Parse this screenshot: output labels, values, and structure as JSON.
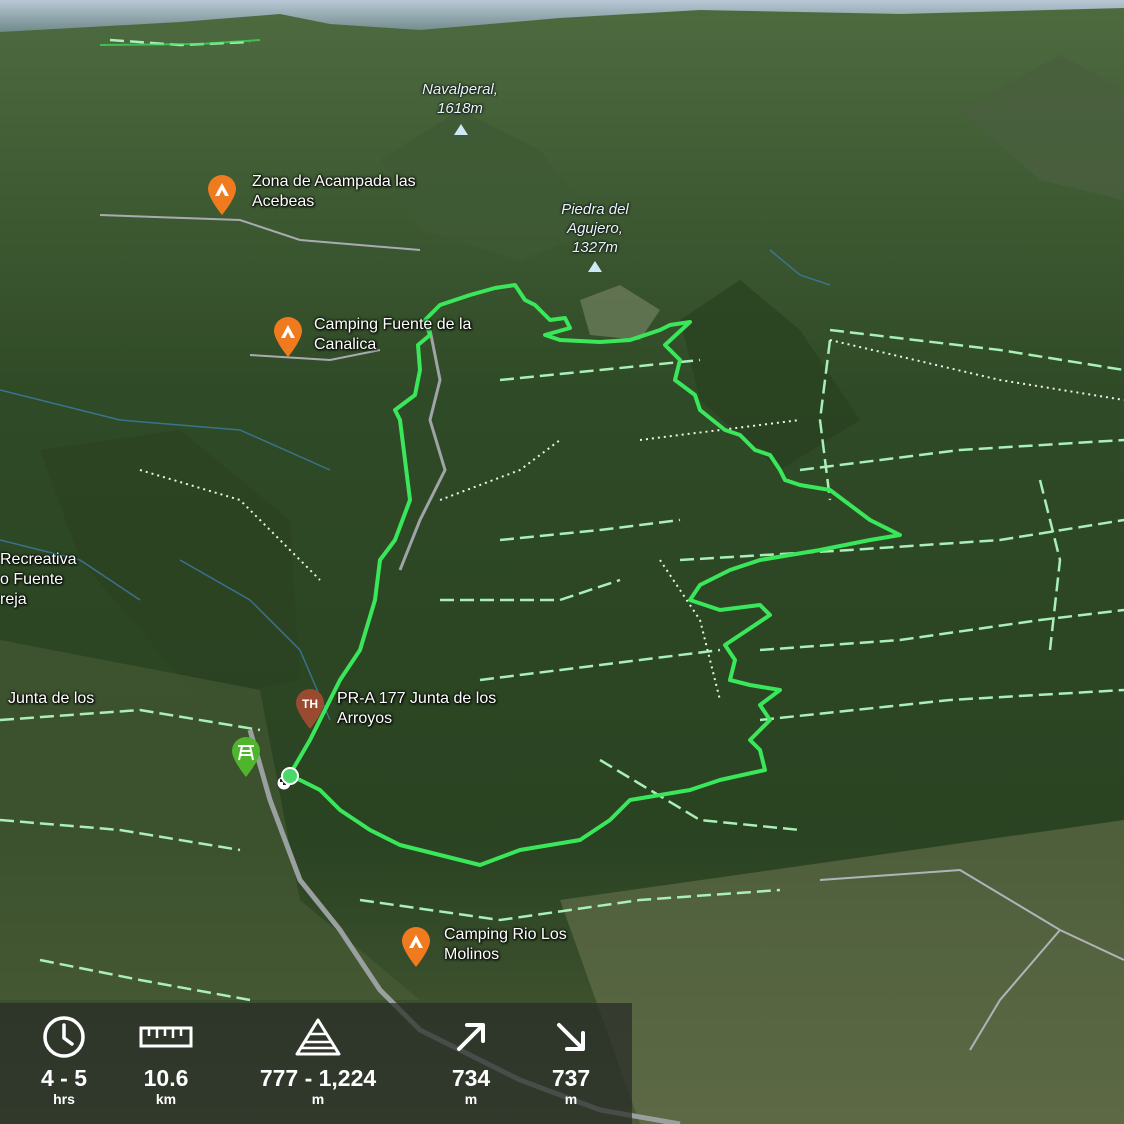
{
  "map": {
    "peaks": [
      {
        "name": "Navalperal,",
        "elevation": "1618m"
      },
      {
        "name": "Piedra del",
        "name2": "Agujero,",
        "elevation": "1327m"
      }
    ],
    "camps": [
      {
        "line1": "Zona de Acampada las",
        "line2": "Acebeas"
      },
      {
        "line1": "Camping Fuente de la",
        "line2": "Canalica"
      },
      {
        "line1": "Camping Rio Los",
        "line2": "Molinos"
      }
    ],
    "trailhead": {
      "badge": "TH",
      "line1": "PR-A 177 Junta de los",
      "line2": "Arroyos"
    },
    "partial_labels": {
      "recreativa_1": "Recreativa",
      "recreativa_2": "o Fuente",
      "recreativa_3": "reja",
      "junta": "Junta de los"
    },
    "colors": {
      "route": "#39e85a",
      "trail": "#a8f0b8",
      "camp": "#f07a1e",
      "trailhead": "#9a4a2e",
      "picnic": "#4fb52c"
    }
  },
  "stats": {
    "duration": {
      "icon": "clock-icon",
      "value": "4 - 5",
      "unit": "hrs"
    },
    "distance": {
      "icon": "ruler-icon",
      "value": "10.6",
      "unit": "km"
    },
    "elevation": {
      "icon": "mountain-icon",
      "value": "777 - 1,224",
      "unit": "m"
    },
    "ascent": {
      "icon": "arrow-up-right-icon",
      "value": "734",
      "unit": "m"
    },
    "descent": {
      "icon": "arrow-down-right-icon",
      "value": "737",
      "unit": "m"
    }
  }
}
